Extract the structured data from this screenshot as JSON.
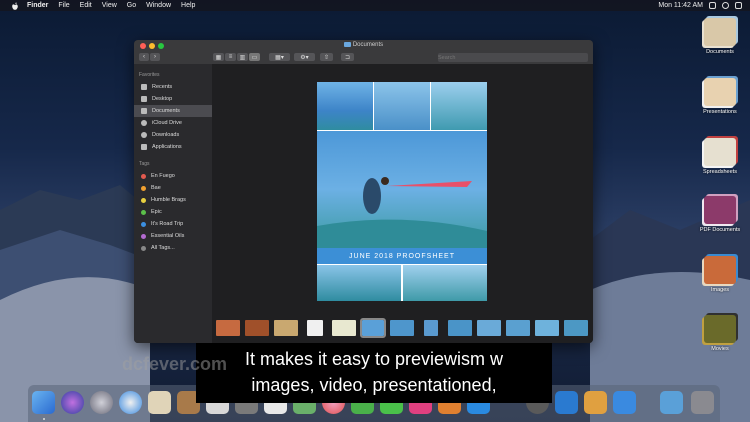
{
  "menubar": {
    "items": [
      "Finder",
      "File",
      "Edit",
      "View",
      "Go",
      "Window",
      "Help"
    ],
    "clock": "Mon 11:42 AM"
  },
  "desktop": {
    "icons": [
      {
        "label": "Documents",
        "color": "#d9c8a8"
      },
      {
        "label": "Presentations",
        "color": "#e8d2b0"
      },
      {
        "label": "Spreadsheets",
        "color": "#e6e0d0"
      },
      {
        "label": "PDF Documents",
        "color": "#8c3a6a"
      },
      {
        "label": "Images",
        "color": "#c96a3a"
      },
      {
        "label": "Movies",
        "color": "#6a6a2a"
      }
    ]
  },
  "window": {
    "title": "Documents",
    "search_placeholder": "Search",
    "sidebar": {
      "favorites_header": "Favorites",
      "favorites": [
        "Recents",
        "Desktop",
        "Documents",
        "iCloud Drive",
        "Downloads",
        "Applications"
      ],
      "tags_header": "Tags",
      "tags": [
        {
          "label": "En Fuego",
          "color": "#e25a4f"
        },
        {
          "label": "Bae",
          "color": "#f0a030"
        },
        {
          "label": "Humble Brags",
          "color": "#e8d040"
        },
        {
          "label": "Epic",
          "color": "#5bc04a"
        },
        {
          "label": "It's Road Trip",
          "color": "#3b8fe0"
        },
        {
          "label": "Essential Oils",
          "color": "#b36ad0"
        },
        {
          "label": "All Tags...",
          "color": "#888888"
        }
      ]
    },
    "preview": {
      "banner": "JUNE 2018 PROOFSHEET"
    }
  },
  "caption": {
    "line1": "It makes it easy to previewism w",
    "line2": "images, video, presentationed,"
  },
  "watermark": "dcfever.com"
}
